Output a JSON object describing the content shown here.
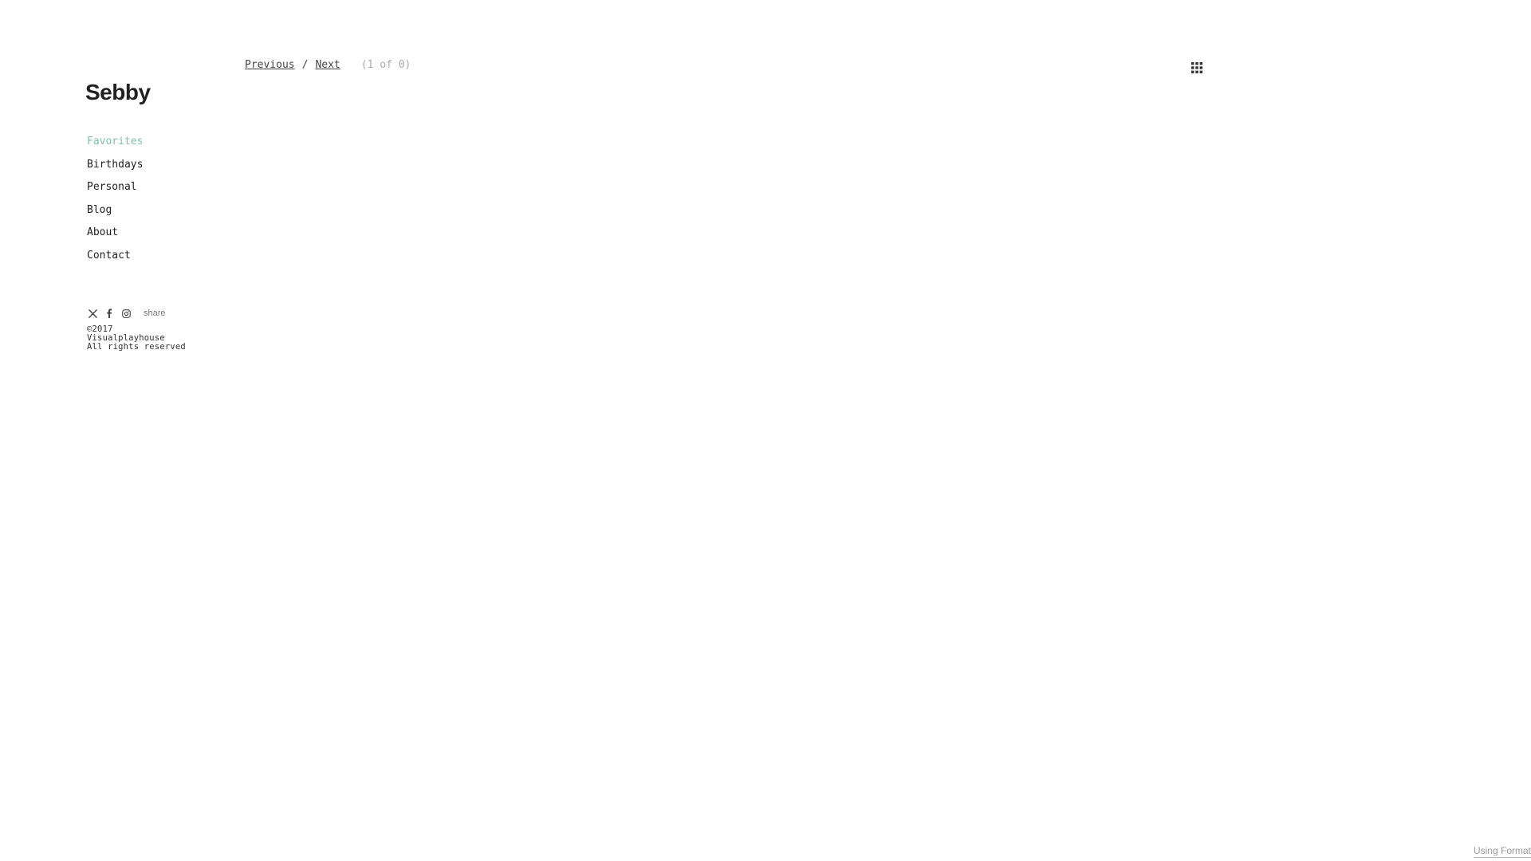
{
  "site": {
    "title": "Sebby"
  },
  "nav": {
    "items": [
      {
        "label": "Favorites",
        "active": true
      },
      {
        "label": "Birthdays",
        "active": false
      },
      {
        "label": "Personal",
        "active": false
      },
      {
        "label": "Blog",
        "active": false
      },
      {
        "label": "About",
        "active": false
      },
      {
        "label": "Contact",
        "active": false
      }
    ]
  },
  "social": {
    "icons": [
      "x-icon",
      "facebook-icon",
      "instagram-icon"
    ],
    "share_label": "share"
  },
  "copyright": {
    "line1": "©2017",
    "line2": "Visualplayhouse",
    "line3": "All rights reserved"
  },
  "pager": {
    "previous_label": "Previous",
    "separator": "/",
    "next_label": "Next",
    "count": "(1 of 0)"
  },
  "footer": {
    "credit": "Using Format"
  },
  "colors": {
    "active_nav": "#7fc3a6",
    "text": "#222222",
    "muted": "#aaaaaa"
  }
}
